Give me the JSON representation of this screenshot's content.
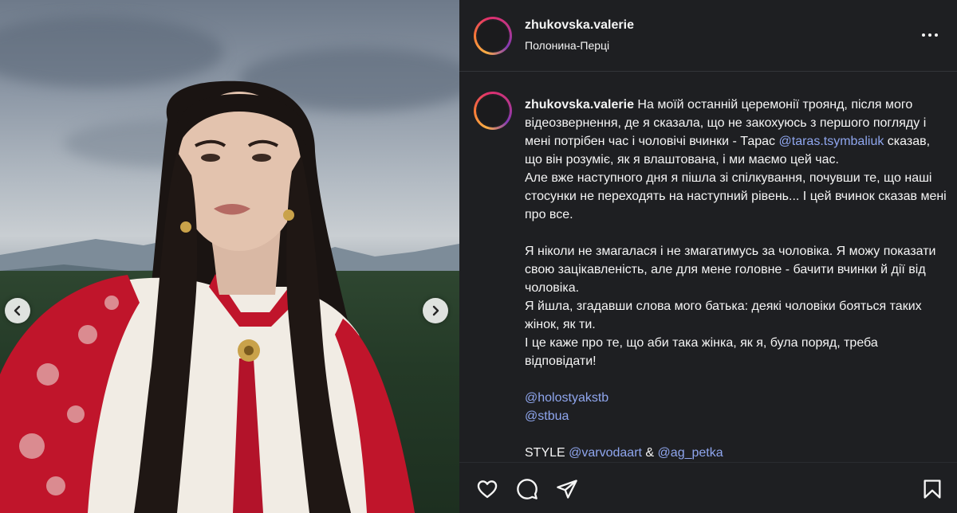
{
  "post": {
    "username": "zhukovska.valerie",
    "location": "Полонина-Перці"
  },
  "caption": {
    "username": "zhukovska.valerie",
    "p1_a": "На моїй останній церемонії троянд, після мого відеозвернення, де я сказала, що не закохуюсь з першого погляду і мені потрібен час і чоловічі вчинки - Тарас ",
    "p1_mention": "@taras.tsymbaliuk",
    "p1_b": " сказав, що він розуміє, як я влаштована, і ми маємо цей час.",
    "p2": "Але вже наступного дня я пішла зі спілкування, почувши те, що наші стосунки не переходять на наступний рівень... І цей вчинок сказав мені про все.",
    "p3": "Я ніколи не змагалася і не змагатимусь за чоловіка. Я можу показати свою зацікавленість, але для мене головне - бачити вчинки й дії від чоловіка.",
    "p4": "Я йшла, згадавши слова мого батька: деякі чоловіки бояться таких жінок, як ти.",
    "p5": "І це каже про те, що аби така жінка, як я, була поряд, треба відповідати!",
    "mention_1": "@holostyakstb",
    "mention_2": "@stbua",
    "style_label": "STYLE ",
    "style_mention_1": "@varvodaart",
    "style_amp": " & ",
    "style_mention_2": "@ag_petka"
  },
  "icons": {
    "carousel_prev": "chevron-left-icon",
    "carousel_next": "chevron-right-icon",
    "more": "more-horizontal-icon",
    "like": "heart-icon",
    "comment": "comment-icon",
    "share": "paper-plane-icon",
    "save": "bookmark-icon"
  },
  "colors": {
    "panel_bg": "#1e1f22",
    "mention": "#8fa6ee",
    "text": "#f5f5f5",
    "embroidery_red": "#c0152b"
  }
}
